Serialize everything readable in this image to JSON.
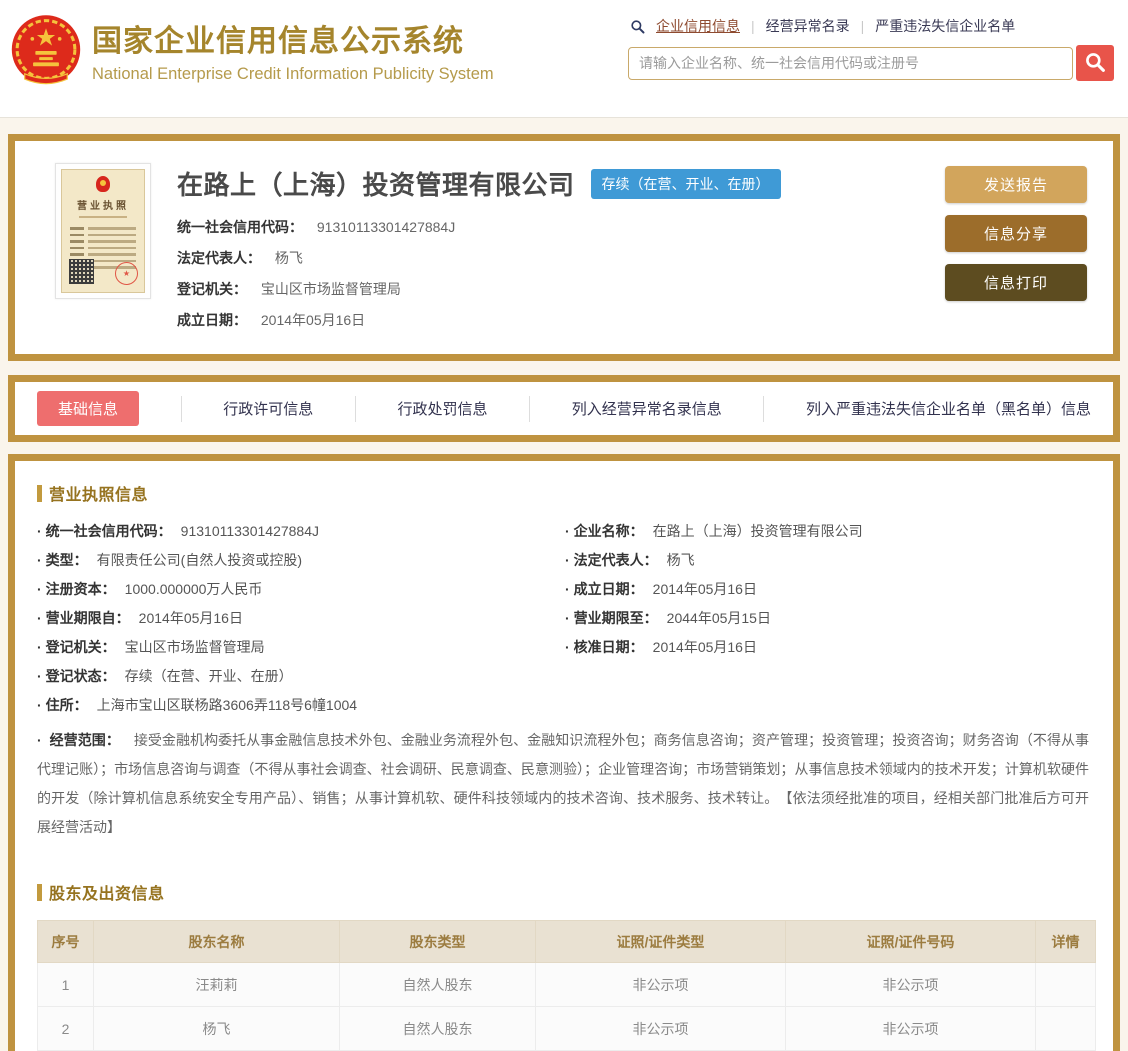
{
  "header": {
    "title": "国家企业信用信息公示系统",
    "subtitle": "National Enterprise Credit Information Publicity System",
    "nav": [
      {
        "label": "企业信用信息",
        "active": true
      },
      {
        "label": "经营异常名录",
        "active": false
      },
      {
        "label": "严重违法失信企业名单",
        "active": false
      }
    ],
    "search": {
      "placeholder": "请输入企业名称、统一社会信用代码或注册号"
    }
  },
  "company": {
    "name": "在路上（上海）投资管理有限公司",
    "status_badge": "存续（在营、开业、在册）",
    "license_thumb": {
      "title": "营业执照"
    },
    "summary": [
      {
        "label": "统一社会信用代码：",
        "value": "91310113301427884J"
      },
      {
        "label": "法定代表人：",
        "value": "杨飞"
      },
      {
        "label": "登记机关：",
        "value": "宝山区市场监督管理局"
      },
      {
        "label": "成立日期：",
        "value": "2014年05月16日"
      }
    ],
    "actions": [
      {
        "label": "发送报告"
      },
      {
        "label": "信息分享"
      },
      {
        "label": "信息打印"
      }
    ]
  },
  "tabs": [
    {
      "label": "基础信息",
      "active": true
    },
    {
      "label": "行政许可信息",
      "active": false
    },
    {
      "label": "行政处罚信息",
      "active": false
    },
    {
      "label": "列入经营异常名录信息",
      "active": false
    },
    {
      "label": "列入严重违法失信企业名单（黑名单）信息",
      "active": false
    }
  ],
  "license": {
    "title": "营业执照信息",
    "left": [
      {
        "label": "统一社会信用代码：",
        "value": "91310113301427884J"
      },
      {
        "label": "类型：",
        "value": "有限责任公司(自然人投资或控股)"
      },
      {
        "label": "注册资本：",
        "value": "1000.000000万人民币"
      },
      {
        "label": "营业期限自：",
        "value": "2014年05月16日"
      },
      {
        "label": "登记机关：",
        "value": "宝山区市场监督管理局"
      },
      {
        "label": "登记状态：",
        "value": "存续（在营、开业、在册）"
      },
      {
        "label": "住所：",
        "value": "上海市宝山区联杨路3606弄118号6幢1004"
      }
    ],
    "right": [
      {
        "label": "企业名称：",
        "value": "在路上（上海）投资管理有限公司"
      },
      {
        "label": "法定代表人：",
        "value": "杨飞"
      },
      {
        "label": "成立日期：",
        "value": "2014年05月16日"
      },
      {
        "label": "营业期限至：",
        "value": "2044年05月15日"
      },
      {
        "label": "核准日期：",
        "value": "2014年05月16日"
      }
    ],
    "scope": {
      "label": "经营范围：",
      "text": "接受金融机构委托从事金融信息技术外包、金融业务流程外包、金融知识流程外包；商务信息咨询；资产管理；投资管理；投资咨询；财务咨询（不得从事代理记账）；市场信息咨询与调查（不得从事社会调查、社会调研、民意调查、民意测验）；企业管理咨询；市场营销策划；从事信息技术领域内的技术开发；计算机软硬件的开发（除计算机信息系统安全专用产品）、销售；从事计算机软、硬件科技领域内的技术咨询、技术服务、技术转让。　【依法须经批准的项目，经相关部门批准后方可开展经营活动】"
    }
  },
  "shareholders": {
    "title": "股东及出资信息",
    "columns": [
      "序号",
      "股东名称",
      "股东类型",
      "证照/证件类型",
      "证照/证件号码",
      "详情"
    ],
    "rows": [
      [
        "1",
        "汪莉莉",
        "自然人股东",
        "非公示项",
        "非公示项",
        ""
      ],
      [
        "2",
        "杨飞",
        "自然人股东",
        "非公示项",
        "非公示项",
        ""
      ]
    ]
  },
  "colors": {
    "brand_gold_border": "#bf9340",
    "title_gold": "#a5852c",
    "page_background": "#faf5ec",
    "status_badge_blue": "#3f9ad6",
    "active_tab_red": "#ee6e6e",
    "search_button_red": "#e8544a",
    "button_report": "#d2a55c",
    "button_share": "#9c6d2b",
    "button_print": "#5d4c20",
    "section_title_brown": "#96731f"
  }
}
